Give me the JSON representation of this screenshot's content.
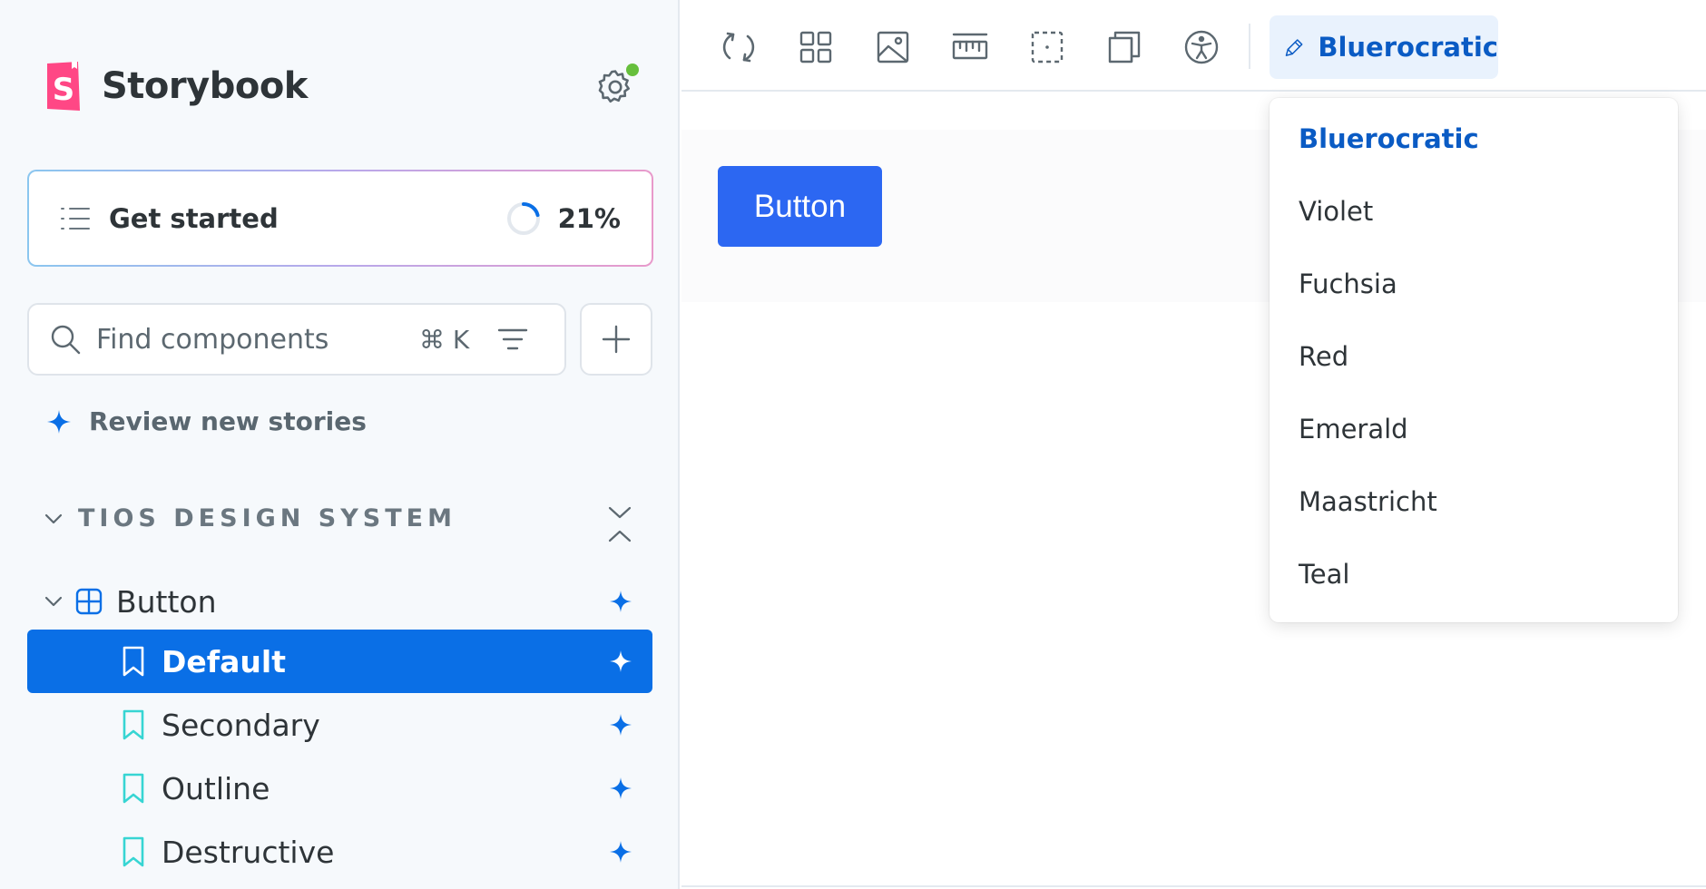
{
  "brand": {
    "name": "Storybook"
  },
  "onboarding": {
    "label": "Get started",
    "progress_text": "21%",
    "progress": 0.21
  },
  "search": {
    "placeholder": "Find components",
    "shortcut": "⌘ K"
  },
  "review": {
    "label": "Review new stories"
  },
  "sidebar": {
    "group": "TIOS DESIGN SYSTEM",
    "component": "Button",
    "stories": [
      {
        "label": "Default",
        "selected": true
      },
      {
        "label": "Secondary",
        "selected": false
      },
      {
        "label": "Outline",
        "selected": false
      },
      {
        "label": "Destructive",
        "selected": false
      }
    ]
  },
  "toolbar": {
    "tools": [
      "reload-icon",
      "grid-icon",
      "image-icon",
      "ruler-icon",
      "outline-icon",
      "viewport-icon",
      "accessibility-icon"
    ],
    "theme_label": "Bluerocratic"
  },
  "preview": {
    "button_label": "Button"
  },
  "theme_menu": {
    "selected": "Bluerocratic",
    "options": [
      "Bluerocratic",
      "Violet",
      "Fuchsia",
      "Red",
      "Emerald",
      "Maastricht",
      "Teal"
    ]
  },
  "colors": {
    "accent": "#0a6fe6",
    "story_icon": "#37d5d3",
    "preview_button": "#2c67f2",
    "status_dot": "#66bf3c"
  }
}
